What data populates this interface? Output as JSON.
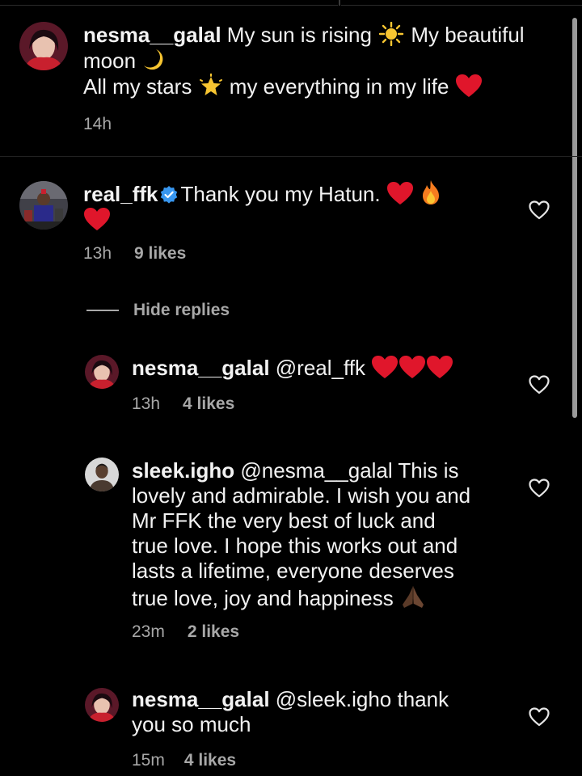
{
  "comments": [
    {
      "username": "nesma__galal",
      "text_line1": " My sun is rising ",
      "text_mid1": " My beautiful",
      "text_line2": "moon ",
      "text_line3": "All my stars ",
      "text_line3b": " my everything in my life ",
      "time": "14h"
    },
    {
      "username": "real_ffk",
      "text": "Thank you my Hatun. ",
      "time": "13h",
      "likes": "9 likes"
    }
  ],
  "hide_replies_label": "Hide replies",
  "replies": [
    {
      "username": "nesma__galal",
      "text": " @real_ffk ",
      "time": "13h",
      "likes": "4 likes"
    },
    {
      "username": "sleek.igho",
      "text_line1": " @nesma__galal This is",
      "text_line2": "lovely and admirable. I wish you and",
      "text_line3": "Mr FFK the very best of luck and",
      "text_line4": "true love. I hope this works out and",
      "text_line5": "lasts a lifetime, everyone deserves",
      "text_line6": "true love, joy and happiness ",
      "time": "23m",
      "likes": "2 likes"
    },
    {
      "username": "nesma__galal",
      "text_line1": " @sleek.igho thank",
      "text_line2": "you so much",
      "time": "15m",
      "likes": "4 likes"
    }
  ],
  "icons": {
    "like": "heart-outline-icon",
    "verified": "verified-badge-icon"
  },
  "colors": {
    "background": "#000000",
    "text": "#f2f2f2",
    "meta": "#a8a8a8",
    "heart_red": "#e0162b",
    "verified_blue": "#3897f0"
  }
}
